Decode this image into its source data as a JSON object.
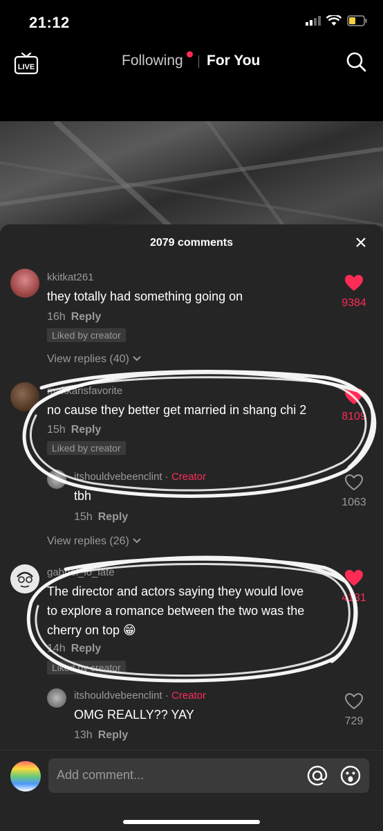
{
  "status_bar": {
    "time": "21:12"
  },
  "top_nav": {
    "following": "Following",
    "for_you": "For You"
  },
  "sheet": {
    "title": "2079 comments"
  },
  "comments": [
    {
      "username": "kkitkat261",
      "text": "they totally had something going on",
      "time": "16h",
      "reply": "Reply",
      "liked_by_creator": "Liked by creator",
      "likes": "9384",
      "view_replies": "View replies (40)"
    },
    {
      "username": "makkarisfavorite",
      "text": "no cause they better get married in shang chi 2",
      "time": "15h",
      "reply": "Reply",
      "liked_by_creator": "Liked by creator",
      "likes": "8109",
      "creator_reply": {
        "username": "itshouldvebeenclint",
        "badge": "Creator",
        "text": "tbh",
        "time": "15h",
        "reply": "Reply",
        "likes": "1063"
      },
      "view_replies": "View replies (26)"
    },
    {
      "username": "gabriel_lo_late",
      "text_lines": [
        "The director and actors saying they would love",
        "to explore a romance between the two was the",
        "cherry on top 😁"
      ],
      "time": "14h",
      "reply": "Reply",
      "liked_by_creator": "Liked by creator",
      "likes": "4131",
      "creator_reply": {
        "username": "itshouldvebeenclint",
        "badge": "Creator",
        "text": "OMG REALLY?? YAY",
        "time": "13h",
        "reply": "Reply",
        "likes": "729"
      }
    }
  ],
  "input_bar": {
    "placeholder": "Add comment..."
  },
  "colors": {
    "accent": "#fe2c55",
    "sheet_bg": "#252525",
    "muted": "#9a9a9a"
  }
}
